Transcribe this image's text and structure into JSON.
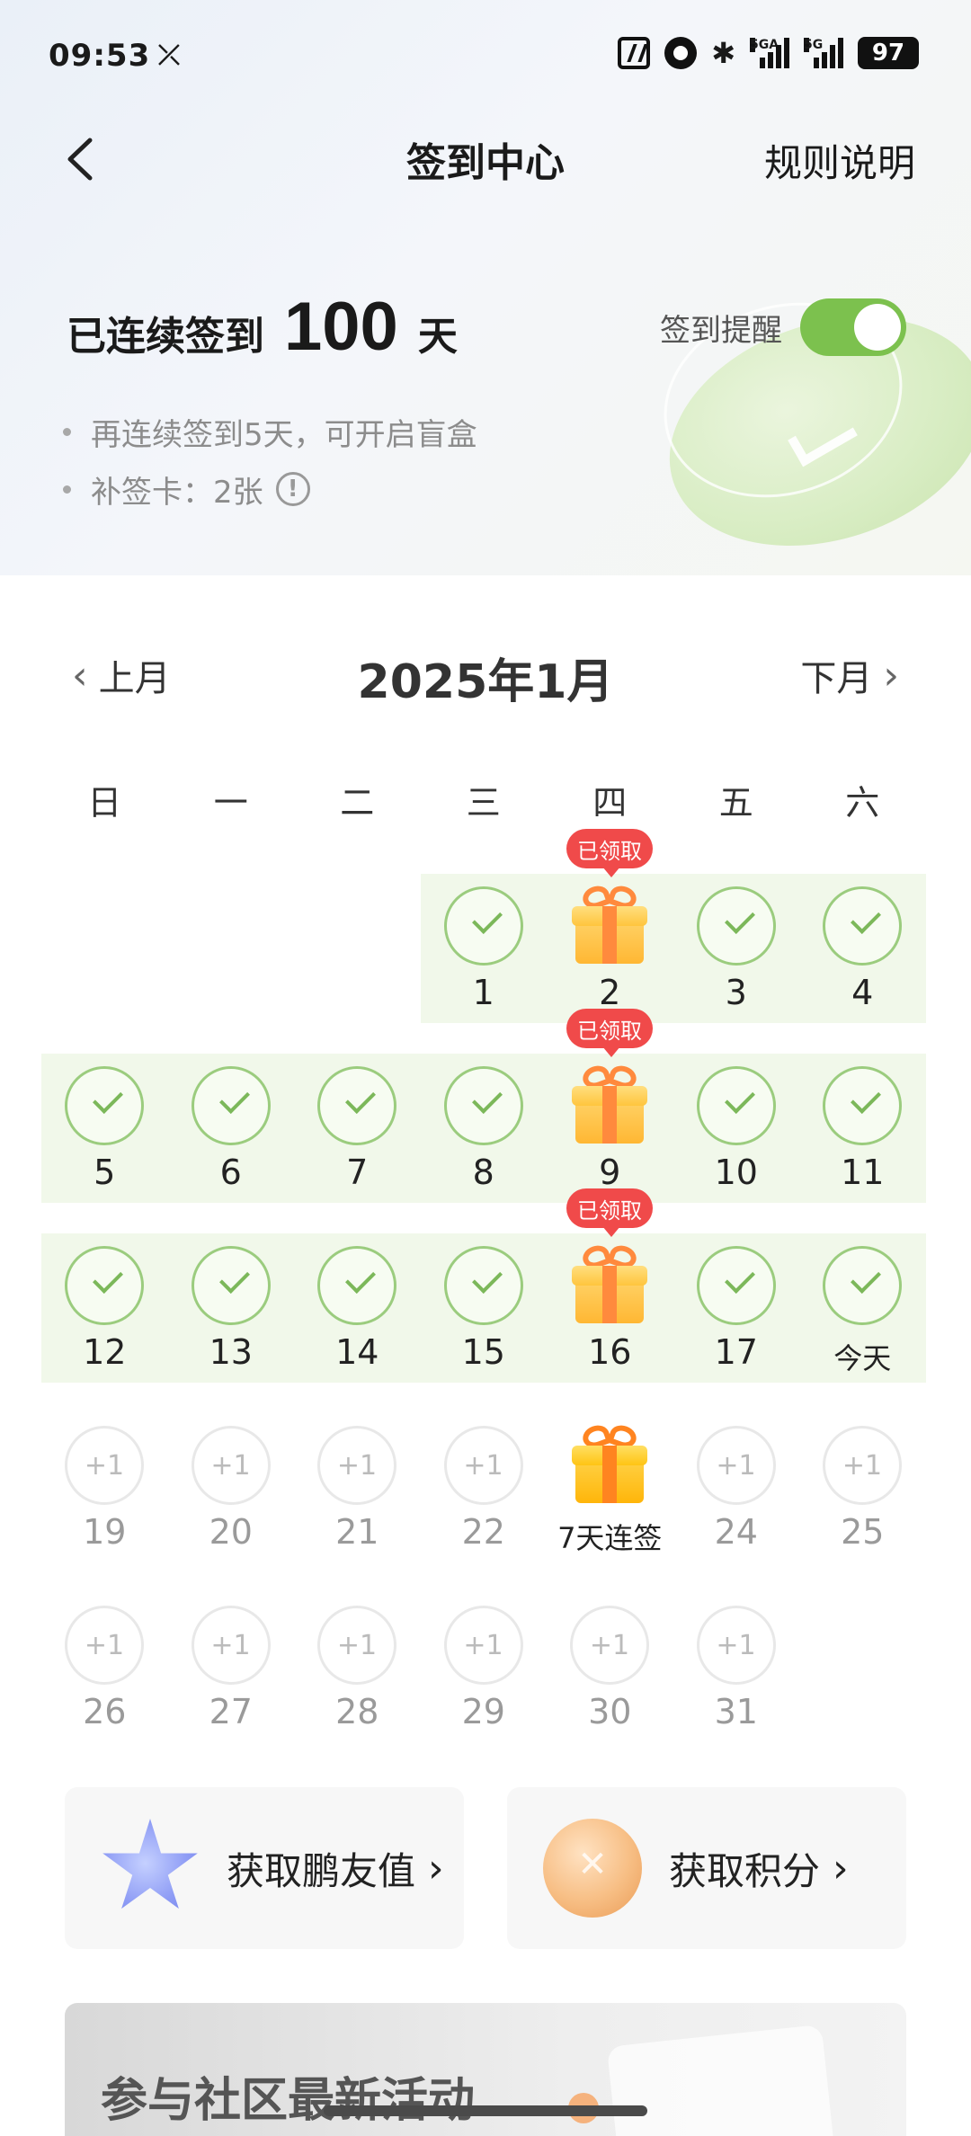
{
  "status": {
    "time": "09:53",
    "net1": "5GA",
    "net2": "5G",
    "battery": "97"
  },
  "header": {
    "title": "签到中心",
    "rules": "规则说明"
  },
  "streak": {
    "prefix": "已连续签到",
    "count": "100",
    "unit": "天"
  },
  "reminder": {
    "label": "签到提醒",
    "enabled": true
  },
  "hints": {
    "box": "再连续签到5天，可开启盲盒",
    "makeup": "补签卡：2张",
    "info_symbol": "!"
  },
  "calendar": {
    "prev": "上月",
    "title": "2025年1月",
    "next": "下月",
    "weekdays": [
      "日",
      "一",
      "二",
      "三",
      "四",
      "五",
      "六"
    ],
    "claimed_label": "已领取",
    "plus_label": "+1",
    "today_label": "今天",
    "streak_gift_label": "7天连签"
  },
  "rewards": {
    "friend": "获取鹏友值",
    "points": "获取积分",
    "chevron": "›"
  },
  "banner": {
    "title": "参与社区最新活动"
  },
  "colors": {
    "accent_green": "#7cc14e",
    "badge_red": "#f04a4a"
  }
}
